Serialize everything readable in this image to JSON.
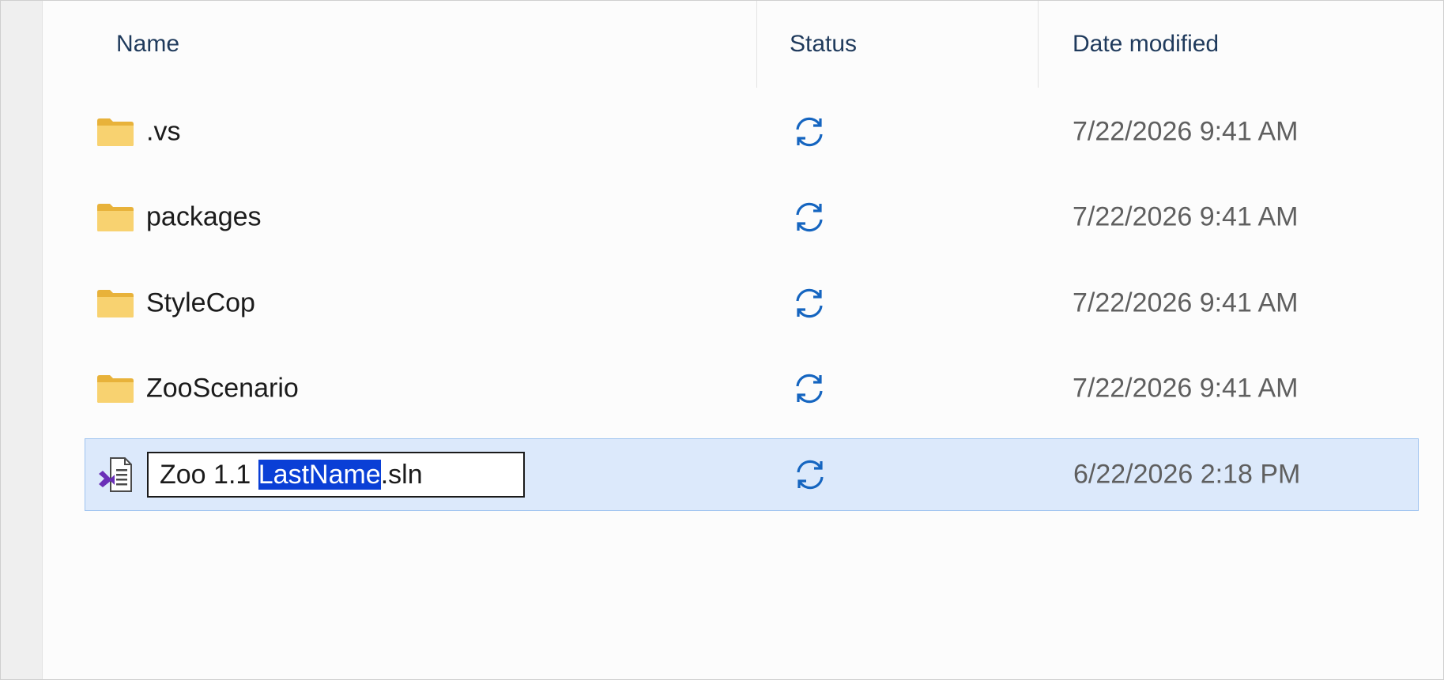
{
  "columns": {
    "name": "Name",
    "status": "Status",
    "date_modified": "Date modified"
  },
  "rows": [
    {
      "name": ".vs",
      "type": "folder",
      "status_icon": "sync-icon",
      "date": "7/22/2026 9:41 AM"
    },
    {
      "name": "packages",
      "type": "folder",
      "status_icon": "sync-icon",
      "date": "7/22/2026 9:41 AM"
    },
    {
      "name": "StyleCop",
      "type": "folder",
      "status_icon": "sync-icon",
      "date": "7/22/2026 9:41 AM"
    },
    {
      "name": "ZooScenario",
      "type": "folder",
      "status_icon": "sync-icon",
      "date": "7/22/2026 9:41 AM"
    }
  ],
  "rename_row": {
    "type": "solution-file",
    "name_prefix": "Zoo 1.1 ",
    "name_selected": "LastName",
    "name_suffix": ".sln",
    "status_icon": "sync-icon",
    "date": "6/22/2026 2:18 PM"
  },
  "colors": {
    "folder": "#f3c44f",
    "sync": "#1565c0",
    "selection_bg": "#dce9fb",
    "text_selection": "#0a3fd6",
    "vs_purple": "#6a2fb8"
  }
}
